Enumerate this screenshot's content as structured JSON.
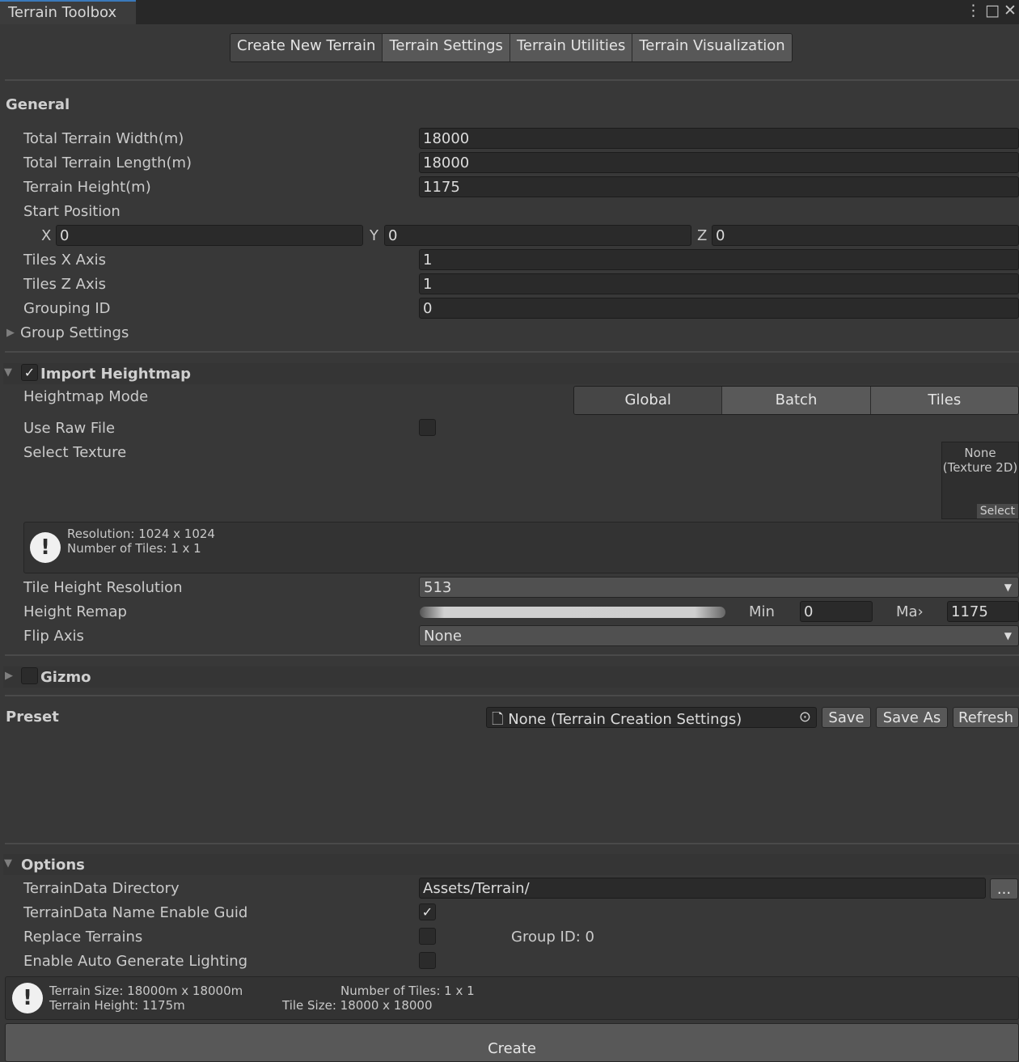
{
  "window": {
    "title": "Terrain Toolbox"
  },
  "tabs": [
    "Create New Terrain",
    "Terrain Settings",
    "Terrain Utilities",
    "Terrain Visualization"
  ],
  "general": {
    "header": "General",
    "width_label": "Total Terrain Width(m)",
    "width_value": "18000",
    "length_label": "Total Terrain Length(m)",
    "length_value": "18000",
    "height_label": "Terrain Height(m)",
    "height_value": "1175",
    "start_label": "Start Position",
    "x_label": "X",
    "x_value": "0",
    "y_label": "Y",
    "y_value": "0",
    "z_label": "Z",
    "z_value": "0",
    "tiles_x_label": "Tiles X Axis",
    "tiles_x_value": "1",
    "tiles_z_label": "Tiles Z Axis",
    "tiles_z_value": "1",
    "grouping_label": "Grouping ID",
    "grouping_value": "0",
    "group_settings_label": "Group Settings"
  },
  "heightmap": {
    "header": "Import Heightmap",
    "enabled": true,
    "mode_label": "Heightmap Mode",
    "modes": [
      "Global",
      "Batch",
      "Tiles"
    ],
    "selected_mode": "Global",
    "raw_label": "Use Raw File",
    "texture_label": "Select Texture",
    "texture_none": "None",
    "texture_type": "(Texture 2D)",
    "texture_select": "Select",
    "info_resolution": "Resolution: 1024 x 1024",
    "info_tiles": "Number of Tiles: 1 x 1",
    "tile_res_label": "Tile Height Resolution",
    "tile_res_value": "513",
    "remap_label": "Height Remap",
    "min_label": "Min",
    "min_value": "0",
    "max_label": "Ma›",
    "max_value": "1175",
    "flip_label": "Flip Axis",
    "flip_value": "None"
  },
  "gizmo": {
    "header": "Gizmo"
  },
  "preset": {
    "label": "Preset",
    "value": "None (Terrain Creation Settings)",
    "save": "Save",
    "save_as": "Save As",
    "refresh": "Refresh"
  },
  "options": {
    "header": "Options",
    "dir_label": "TerrainData Directory",
    "dir_value": "Assets/Terrain/",
    "browse": "...",
    "guid_label": "TerrainData Name Enable Guid",
    "replace_label": "Replace Terrains",
    "group_id_text": "Group ID: 0",
    "lighting_label": "Enable Auto Generate Lighting"
  },
  "summary": {
    "size": "Terrain Size: 18000m x 18000m",
    "height": "Terrain Height: 1175m",
    "tiles": "Number of Tiles: 1 x 1",
    "tile_size": "Tile Size: 18000 x 18000"
  },
  "create_label": "Create",
  "icons": [
    "kebab-menu-icon",
    "maximize-icon",
    "close-icon",
    "foldout-arrow-icon",
    "checkmark-icon",
    "info-icon",
    "object-picker-icon",
    "document-icon",
    "dropdown-arrow-icon"
  ]
}
